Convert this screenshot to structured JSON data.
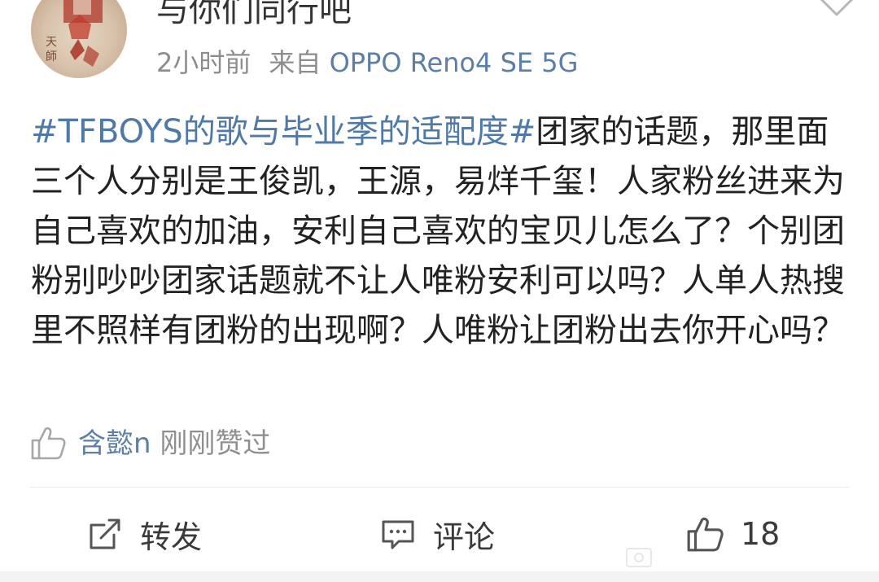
{
  "post": {
    "username": "与你们同行吧",
    "time": "2小时前",
    "source_prefix": "来自",
    "source_device": "OPPO Reno4 SE 5G",
    "hashtag": "#TFBOYS的歌与毕业季的适配度#",
    "text": "团家的话题，那里面三个人分别是王俊凯，王源，易烊千玺！人家粉丝进来为自己喜欢的加油，安利自己喜欢的宝贝儿怎么了？个别团粉别吵吵团家话题就不让人唯粉安利可以吗？人单人热搜里不照样有团粉的出现啊？人唯粉让团粉出去你开心吗？"
  },
  "likes": {
    "liker": "含懿n",
    "suffix": "刚刚赞过"
  },
  "actions": {
    "repost_label": "转发",
    "comment_label": "评论",
    "like_count": "18"
  },
  "icons": {
    "avatar": "red-seal-avatar",
    "menu": "chevron-down-icon",
    "liked_by": "thumbs-up-outline-icon",
    "repost": "repost-icon",
    "comment": "comment-icon",
    "like": "thumbs-up-icon"
  },
  "colors": {
    "link_blue": "#4f79a6",
    "meta_gray": "#8d8d8d",
    "text": "#222222",
    "avatar_red": "#b5483a"
  }
}
